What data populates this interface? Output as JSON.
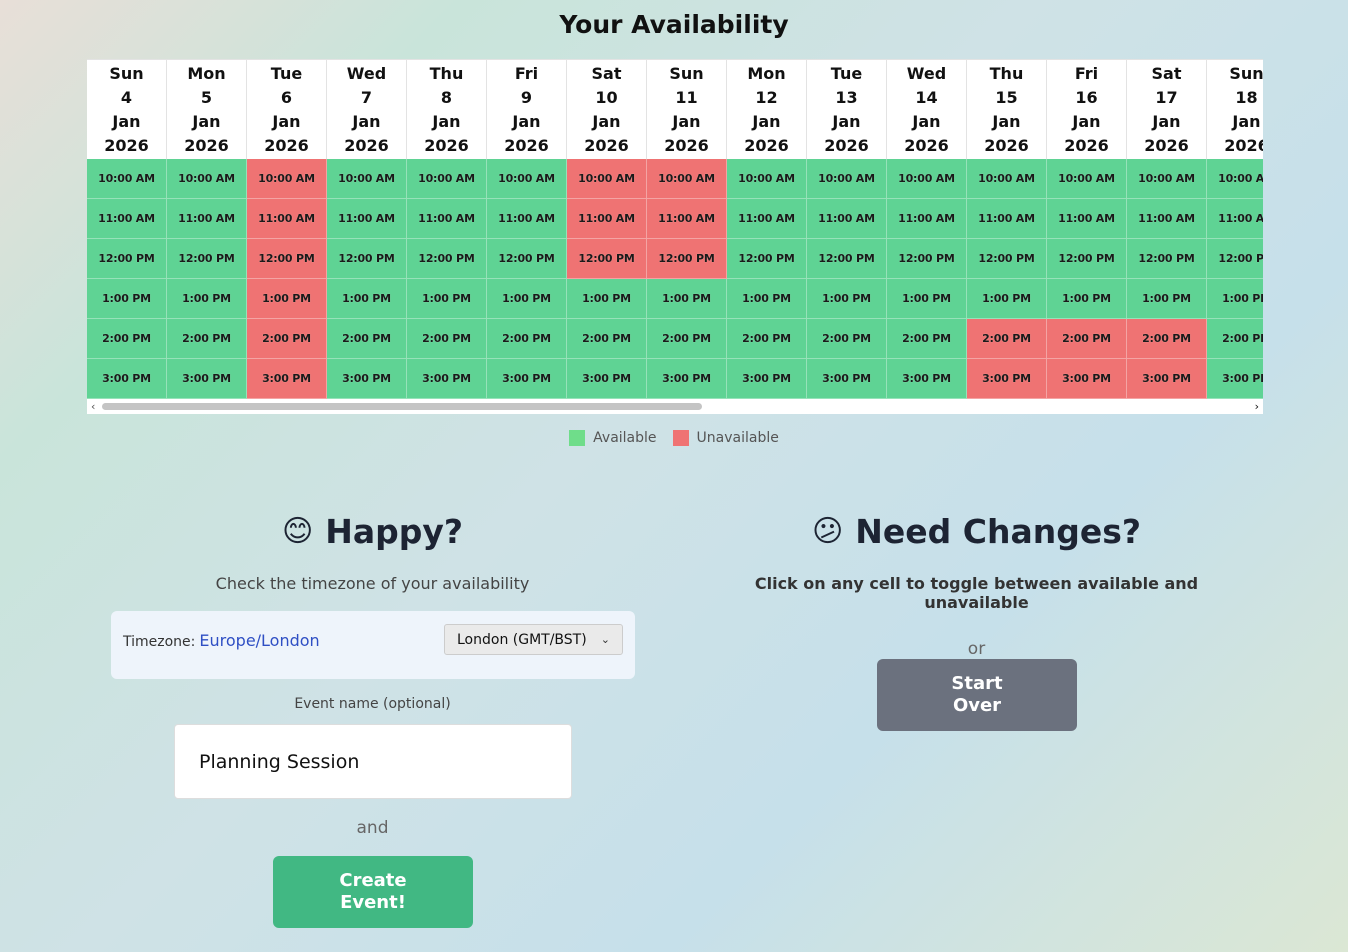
{
  "title": "Your Availability",
  "days": [
    {
      "dow": "Sun",
      "day": "4",
      "month": "Jan",
      "year": "2026",
      "slots": [
        "av",
        "av",
        "av",
        "av",
        "av",
        "av"
      ]
    },
    {
      "dow": "Mon",
      "day": "5",
      "month": "Jan",
      "year": "2026",
      "slots": [
        "av",
        "av",
        "av",
        "av",
        "av",
        "av"
      ]
    },
    {
      "dow": "Tue",
      "day": "6",
      "month": "Jan",
      "year": "2026",
      "slots": [
        "un",
        "un",
        "un",
        "un",
        "un",
        "un"
      ]
    },
    {
      "dow": "Wed",
      "day": "7",
      "month": "Jan",
      "year": "2026",
      "slots": [
        "av",
        "av",
        "av",
        "av",
        "av",
        "av"
      ]
    },
    {
      "dow": "Thu",
      "day": "8",
      "month": "Jan",
      "year": "2026",
      "slots": [
        "av",
        "av",
        "av",
        "av",
        "av",
        "av"
      ]
    },
    {
      "dow": "Fri",
      "day": "9",
      "month": "Jan",
      "year": "2026",
      "slots": [
        "av",
        "av",
        "av",
        "av",
        "av",
        "av"
      ]
    },
    {
      "dow": "Sat",
      "day": "10",
      "month": "Jan",
      "year": "2026",
      "slots": [
        "un",
        "un",
        "un",
        "av",
        "av",
        "av"
      ]
    },
    {
      "dow": "Sun",
      "day": "11",
      "month": "Jan",
      "year": "2026",
      "slots": [
        "un",
        "un",
        "un",
        "av",
        "av",
        "av"
      ]
    },
    {
      "dow": "Mon",
      "day": "12",
      "month": "Jan",
      "year": "2026",
      "slots": [
        "av",
        "av",
        "av",
        "av",
        "av",
        "av"
      ]
    },
    {
      "dow": "Tue",
      "day": "13",
      "month": "Jan",
      "year": "2026",
      "slots": [
        "av",
        "av",
        "av",
        "av",
        "av",
        "av"
      ]
    },
    {
      "dow": "Wed",
      "day": "14",
      "month": "Jan",
      "year": "2026",
      "slots": [
        "av",
        "av",
        "av",
        "av",
        "av",
        "av"
      ]
    },
    {
      "dow": "Thu",
      "day": "15",
      "month": "Jan",
      "year": "2026",
      "slots": [
        "av",
        "av",
        "av",
        "av",
        "un",
        "un"
      ]
    },
    {
      "dow": "Fri",
      "day": "16",
      "month": "Jan",
      "year": "2026",
      "slots": [
        "av",
        "av",
        "av",
        "av",
        "un",
        "un"
      ]
    },
    {
      "dow": "Sat",
      "day": "17",
      "month": "Jan",
      "year": "2026",
      "slots": [
        "av",
        "av",
        "av",
        "av",
        "un",
        "un"
      ]
    },
    {
      "dow": "Sun",
      "day": "18",
      "month": "Jan",
      "year": "2026",
      "slots": [
        "av",
        "av",
        "av",
        "av",
        "av",
        "av"
      ]
    }
  ],
  "times": [
    "10:00 AM",
    "11:00 AM",
    "12:00 PM",
    "1:00 PM",
    "2:00 PM",
    "3:00 PM"
  ],
  "legend": {
    "available": "Available",
    "unavailable": "Unavailable"
  },
  "colors": {
    "available": "#5fd394",
    "unavailable": "#ef7373",
    "create_button": "#41b883",
    "start_button": "#6b717e",
    "timezone_value": "#2f4fc4"
  },
  "happy": {
    "emoji": "😊",
    "title": "Happy?",
    "subtitle": "Check the timezone of your availability",
    "timezone_label": "Timezone:",
    "timezone_value": "Europe/London",
    "timezone_select": "London (GMT/BST)",
    "event_label": "Event name (optional)",
    "event_value": "Planning Session",
    "and": "and",
    "create_button": "Create Event!"
  },
  "changes": {
    "emoji": "😕",
    "title": "Need Changes?",
    "subtitle": "Click on any cell to toggle between available and unavailable",
    "or": "or",
    "start_over_button": "Start Over"
  }
}
